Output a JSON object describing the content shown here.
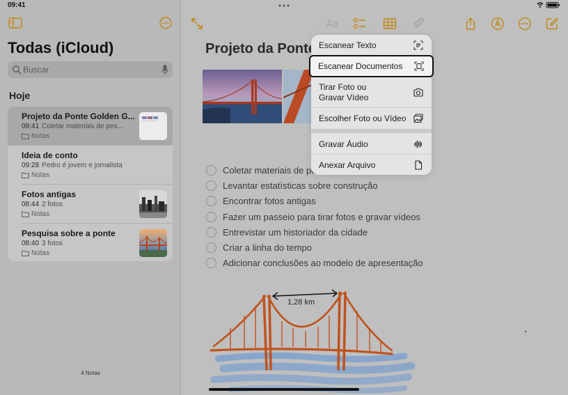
{
  "status_bar": {
    "time": "09:41"
  },
  "sidebar": {
    "folder_title": "Todas (iCloud)",
    "search": {
      "placeholder": "Buscar"
    },
    "section": "Hoje",
    "notes": [
      {
        "title": "Projeto da Ponte Golden G...",
        "time": "09:41",
        "preview": "Coletar materiais de pes...",
        "folder": "Notas",
        "selected": true,
        "thumb": "document"
      },
      {
        "title": "Ideia de conto",
        "time": "09:28",
        "preview": "Pedro é jovem e jornalista",
        "folder": "Notas",
        "selected": false,
        "thumb": null
      },
      {
        "title": "Fotos antigas",
        "time": "08:44",
        "preview": "2 fotos",
        "folder": "Notas",
        "selected": false,
        "thumb": "old-photo"
      },
      {
        "title": "Pesquisa sobre a ponte",
        "time": "08:40",
        "preview": "3 fotos",
        "folder": "Notas",
        "selected": false,
        "thumb": "bridge-photo"
      }
    ],
    "notes_count": "4 Notas"
  },
  "toolbar": {
    "icons": [
      "expand-icon",
      "text-format-icon",
      "checklist-icon",
      "table-icon",
      "attachment-icon",
      "share-icon",
      "markup-icon",
      "more-icon",
      "compose-icon"
    ],
    "text_format_label": "Aa"
  },
  "note": {
    "title": "Projeto da Ponte",
    "checklist": [
      "Coletar materiais de pe",
      "Levantar estatísticas sobre construção",
      "Encontrar fotos antigas",
      "Fazer um passeio para tirar fotos e gravar vídeos",
      "Entrevistar um historiador da cidade",
      "Criar a linha do tempo",
      "Adicionar conclusões ao modelo de apresentação"
    ],
    "sketch_label": "1,28 km"
  },
  "attachment_menu": {
    "items": [
      {
        "label": "Escanear Texto",
        "icon": "scan-text-icon"
      },
      {
        "label": "Escanear Documentos",
        "icon": "scan-document-icon",
        "highlighted": true
      },
      {
        "label": "Tirar Foto ou\nGravar Vídeo",
        "icon": "camera-icon"
      },
      {
        "label": "Escolher Foto ou Vídeo",
        "icon": "photo-library-icon"
      },
      {
        "label": "Gravar Áudio",
        "icon": "waveform-icon"
      },
      {
        "label": "Anexar Arquivo",
        "icon": "document-icon"
      }
    ]
  },
  "colors": {
    "accent": "#c08a17",
    "sidebar_bg": "#b9b9ba",
    "menu_bg": "#e4e4e5",
    "bridge": "#c0521c",
    "water": "#5b8fd6"
  }
}
